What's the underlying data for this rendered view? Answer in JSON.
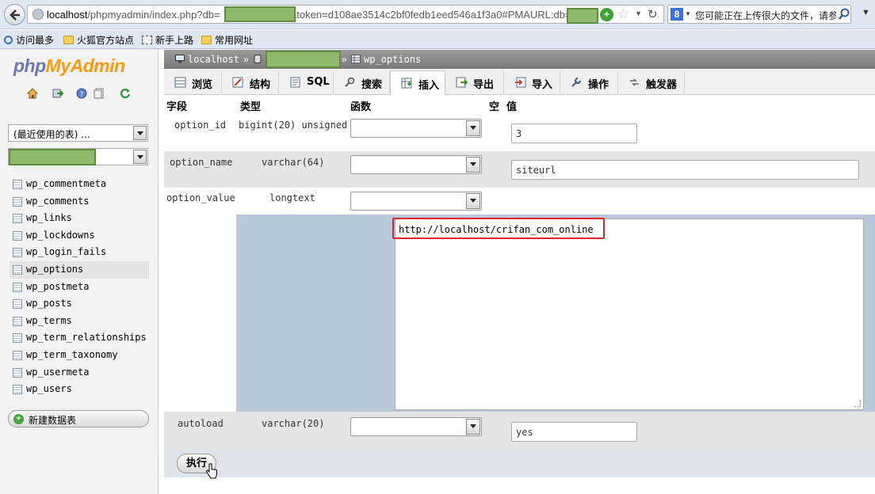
{
  "browser": {
    "url_host": "localhost",
    "url_path_before_mask": "/phpmyadmin/index.php?db=",
    "url_middle": "&token=d108ae3514c2bf0fedb1eed546a1f3a0#PMAURL:db=",
    "search_engine_icon": "8",
    "search_placeholder": "您可能正在上传很大的文件，请参",
    "bookmarks": [
      {
        "label": "访问最多",
        "icon": "search-icon"
      },
      {
        "label": "火狐官方站点",
        "icon": "folder-icon"
      },
      {
        "label": "新手上路",
        "icon": "page-icon"
      },
      {
        "label": "常用网址",
        "icon": "folder-icon"
      }
    ]
  },
  "nav": {
    "logo_php": "php",
    "logo_my": "MyAdmin",
    "recent_tables": "(最近使用的表) ...",
    "tables": [
      "wp_commentmeta",
      "wp_comments",
      "wp_links",
      "wp_lockdowns",
      "wp_login_fails",
      "wp_options",
      "wp_postmeta",
      "wp_posts",
      "wp_terms",
      "wp_term_relationships",
      "wp_term_taxonomy",
      "wp_usermeta",
      "wp_users"
    ],
    "new_db": "新建数据表"
  },
  "breadcrumb": {
    "server": "localhost",
    "sep": "»",
    "table": "wp_options"
  },
  "tabs": [
    {
      "label": "浏览",
      "icon": "browse-icon"
    },
    {
      "label": "结构",
      "icon": "structure-icon"
    },
    {
      "label": "SQL",
      "icon": "sql-icon"
    },
    {
      "label": "搜索",
      "icon": "search-icon"
    },
    {
      "label": "插入",
      "icon": "insert-icon"
    },
    {
      "label": "导出",
      "icon": "export-icon"
    },
    {
      "label": "导入",
      "icon": "import-icon"
    },
    {
      "label": "操作",
      "icon": "wrench-icon"
    },
    {
      "label": "触发器",
      "icon": "trigger-icon"
    }
  ],
  "columns": {
    "field": "字段",
    "type": "类型",
    "function": "函数",
    "null": "空",
    "value": "值"
  },
  "rows": [
    {
      "field": "option_id",
      "type": "bigint(20) unsigned",
      "value": "3"
    },
    {
      "field": "option_name",
      "type": "varchar(64)",
      "value": "siteurl"
    },
    {
      "field": "option_value",
      "type": "longtext",
      "value": "http://localhost/crifan_com_online"
    },
    {
      "field": "autoload",
      "type": "varchar(20)",
      "value": "yes"
    }
  ],
  "submit_label": "执行",
  "colors": {
    "accent_orange": "#f89c0e",
    "logo_blue": "#6c78af",
    "redaction_green": "#8fba6c",
    "highlight_red": "#e3232b"
  }
}
